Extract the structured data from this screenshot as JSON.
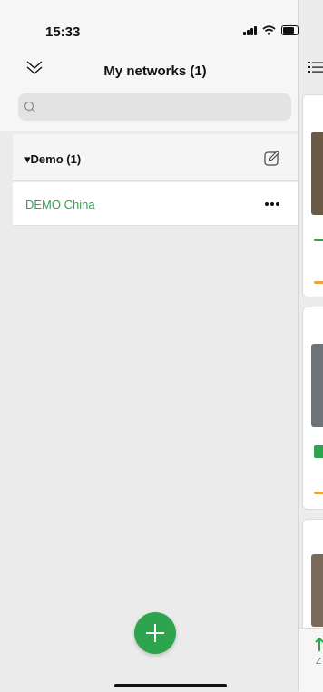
{
  "status_bar": {
    "time": "15:33"
  },
  "header": {
    "title": "My networks (1)"
  },
  "search": {
    "placeholder": "",
    "value": ""
  },
  "groups": [
    {
      "label": "▾Demo (1)",
      "networks": [
        {
          "label": "DEMO China"
        }
      ]
    }
  ],
  "peek": {
    "zoom_label": "Z"
  },
  "icons": {
    "collapse": "double-chevron-down-icon",
    "search": "search-icon",
    "edit": "edit-icon",
    "more": "more-icon",
    "add": "plus-icon"
  },
  "colors": {
    "accent": "#2fa44f",
    "warning": "#f0a040",
    "background": "#ebebeb"
  }
}
